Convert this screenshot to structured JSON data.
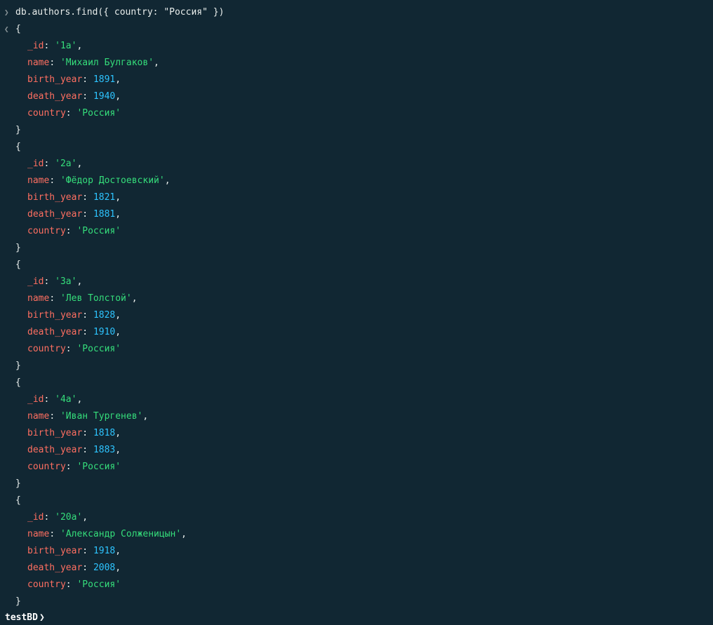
{
  "shell": {
    "input_marker": "❯",
    "output_marker": "❮",
    "command": "db.authors.find({ country: \"Россия\" })",
    "prompt_db": "testBD",
    "prompt_caret": "❯"
  },
  "syntax_colors": {
    "background": "#112733",
    "key": "#ff6f61",
    "string": "#35de7b",
    "number": "#2dc4ff",
    "text": "#e8edeb"
  },
  "documents": [
    {
      "_id": "'1a'",
      "name": "'Михаил Булгаков'",
      "birth_year": "1891",
      "death_year": "1940",
      "country": "'Россия'"
    },
    {
      "_id": "'2a'",
      "name": "'Фёдор Достоевский'",
      "birth_year": "1821",
      "death_year": "1881",
      "country": "'Россия'"
    },
    {
      "_id": "'3a'",
      "name": "'Лев Толстой'",
      "birth_year": "1828",
      "death_year": "1910",
      "country": "'Россия'"
    },
    {
      "_id": "'4a'",
      "name": "'Иван Тургенев'",
      "birth_year": "1818",
      "death_year": "1883",
      "country": "'Россия'"
    },
    {
      "_id": "'20a'",
      "name": "'Александр Солженицын'",
      "birth_year": "1918",
      "death_year": "2008",
      "country": "'Россия'"
    }
  ],
  "field_keys": {
    "id": "_id",
    "name": "name",
    "birth_year": "birth_year",
    "death_year": "death_year",
    "country": "country"
  }
}
